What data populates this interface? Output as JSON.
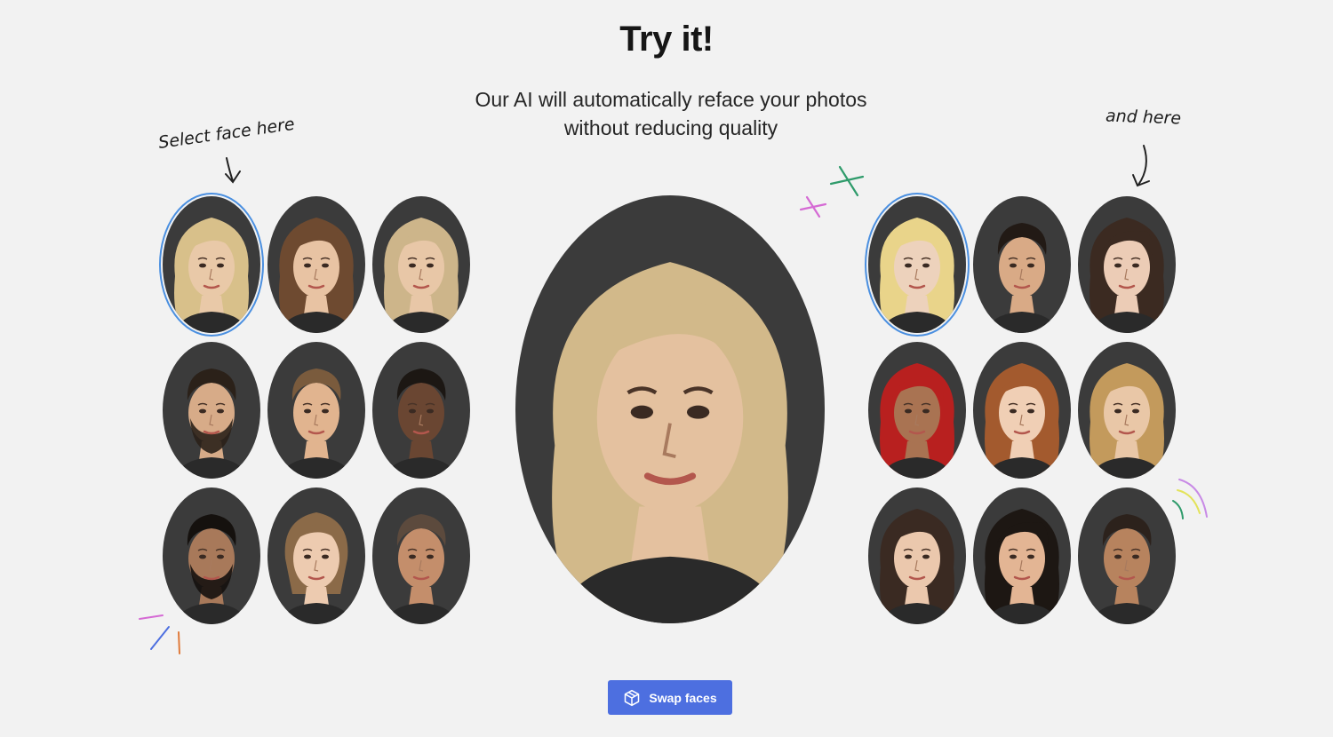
{
  "header": {
    "title": "Try it!",
    "subtitle": "Our AI will automatically reface your photos without reducing quality"
  },
  "hints": {
    "left": "Select face here",
    "right": "and here"
  },
  "source_faces": {
    "selected_index": 0,
    "items": [
      {
        "hair": "#d8c08a",
        "skin": "#e9c9a8",
        "style": "long"
      },
      {
        "hair": "#6e4a30",
        "skin": "#e8c3a3",
        "style": "long"
      },
      {
        "hair": "#cdb58a",
        "skin": "#e8c7a7",
        "style": "long"
      },
      {
        "hair": "#2b2119",
        "skin": "#d7ab88",
        "style": "beard"
      },
      {
        "hair": "#7a5b3d",
        "skin": "#e1b48f",
        "style": "short"
      },
      {
        "hair": "#1c1713",
        "skin": "#6a4632",
        "style": "short"
      },
      {
        "hair": "#15110e",
        "skin": "#a8795a",
        "style": "beard"
      },
      {
        "hair": "#8b6a48",
        "skin": "#edcbb0",
        "style": "bun"
      },
      {
        "hair": "#5c4a3d",
        "skin": "#c48e6b",
        "style": "short"
      }
    ]
  },
  "target_faces": {
    "selected_index": 0,
    "items": [
      {
        "hair": "#e9d48a",
        "skin": "#edd2bc",
        "style": "long"
      },
      {
        "hair": "#221a15",
        "skin": "#d9aa86",
        "style": "short"
      },
      {
        "hair": "#3b2a21",
        "skin": "#ecccb6",
        "style": "long"
      },
      {
        "hair": "#b8201f",
        "skin": "#a97352",
        "style": "long"
      },
      {
        "hair": "#a35a2e",
        "skin": "#f0cfb5",
        "style": "long"
      },
      {
        "hair": "#c39a5c",
        "skin": "#e9c7a7",
        "style": "long"
      },
      {
        "hair": "#3a2a22",
        "skin": "#ebc8ad",
        "style": "long"
      },
      {
        "hair": "#1d1713",
        "skin": "#e3b594",
        "style": "long"
      },
      {
        "hair": "#2c221c",
        "skin": "#b7835e",
        "style": "short"
      }
    ]
  },
  "result_face": {
    "hair": "#d2b98a",
    "skin": "#e4c19f",
    "style": "long"
  },
  "actions": {
    "swap_label": "Swap faces",
    "swap_icon": "box-icon"
  },
  "colors": {
    "accent": "#4d6fe0",
    "selection_ring": "#4a8fe0",
    "background": "#f2f2f2"
  }
}
